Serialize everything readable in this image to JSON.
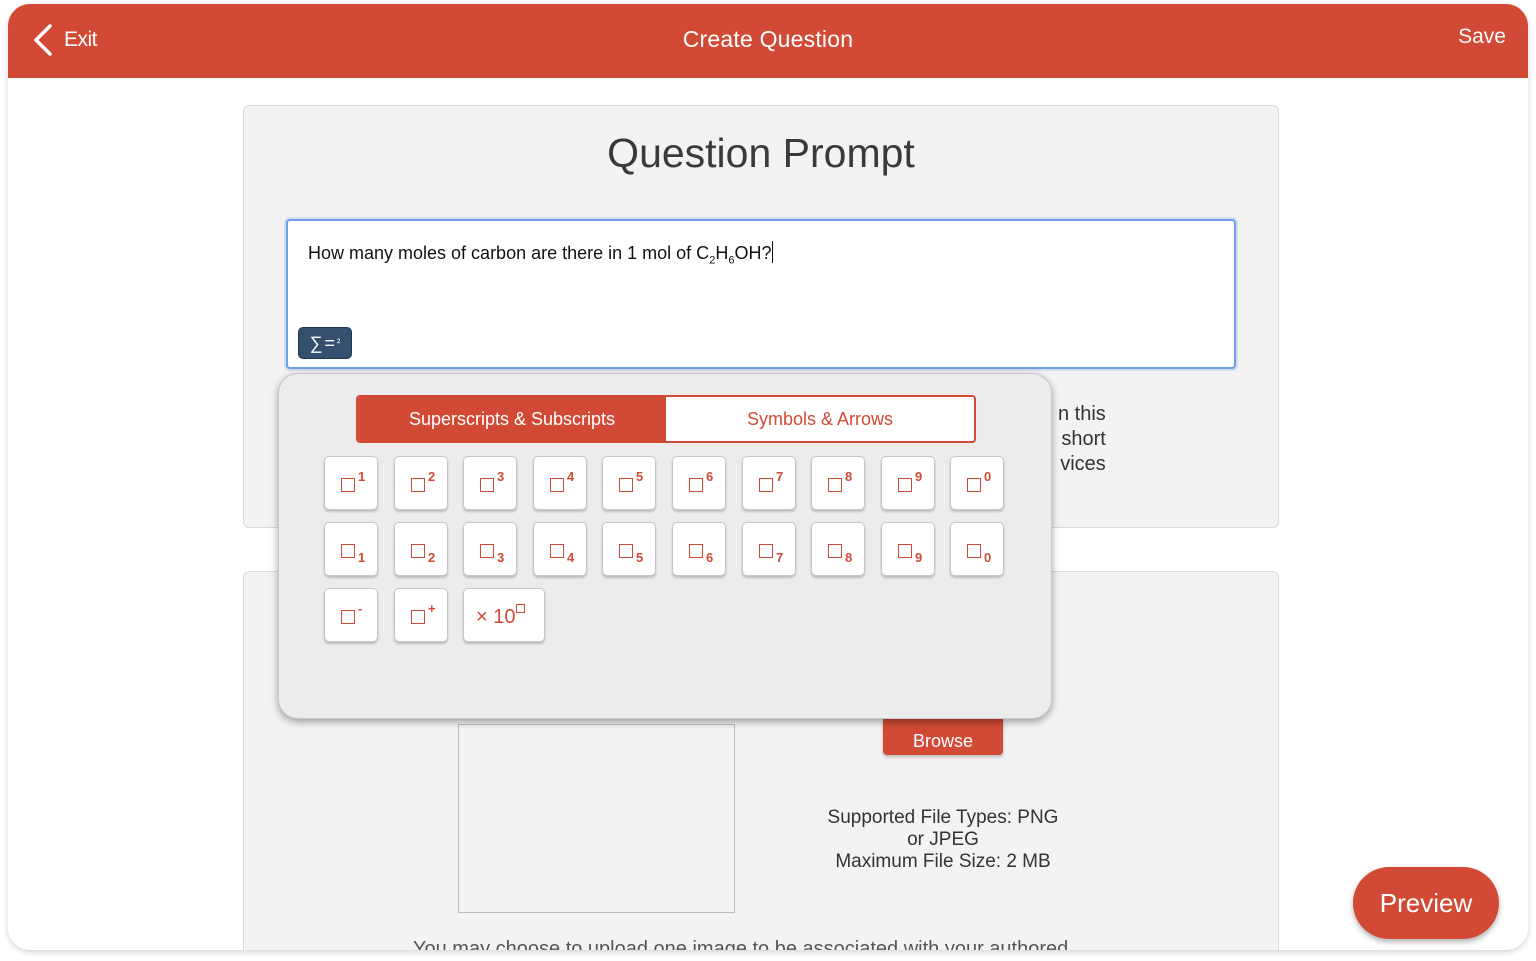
{
  "header": {
    "exit_label": "Exit",
    "title": "Create Question",
    "save_label": "Save"
  },
  "prompt_card": {
    "heading": "Question Prompt",
    "text_before": "How many moles of carbon are there in 1 mol of C",
    "sub1": "2",
    "text_mid": "H",
    "sub2": "6",
    "text_after": "OH?",
    "math_button": {
      "sigma": "∑",
      "equals": "=",
      "exp": "²"
    },
    "partial_lines": [
      "n this",
      "short",
      "vices"
    ]
  },
  "popup": {
    "tabs": [
      "Superscripts & Subscripts",
      "Symbols & Arrows"
    ],
    "superscripts": [
      "1",
      "2",
      "3",
      "4",
      "5",
      "6",
      "7",
      "8",
      "9",
      "0"
    ],
    "subscripts": [
      "1",
      "2",
      "3",
      "4",
      "5",
      "6",
      "7",
      "8",
      "9",
      "0"
    ],
    "signs": [
      "-",
      "+"
    ],
    "sci_label": "× 10"
  },
  "upload": {
    "browse_label": "Browse",
    "file_types": "Supported File Types: PNG",
    "file_types_2": "or JPEG",
    "max_size": "Maximum File Size: 2 MB",
    "bottom_note": "You may choose to upload one image to be associated with your authored"
  },
  "preview_label": "Preview",
  "colors": {
    "brand": "#d24a35",
    "editor_border": "#6d9ee8",
    "math_button": "#35506e"
  }
}
